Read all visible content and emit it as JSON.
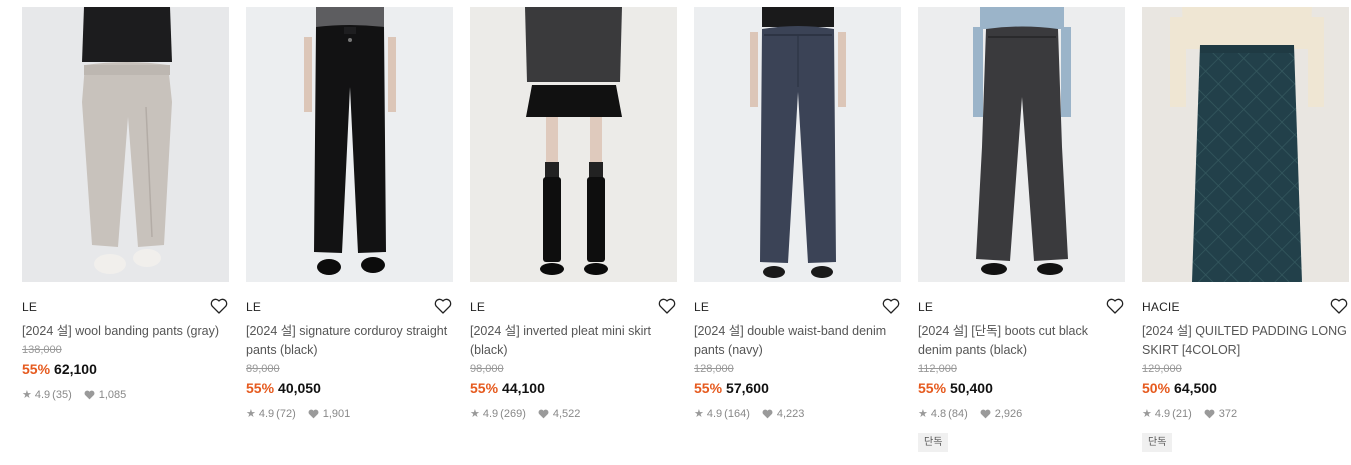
{
  "products": [
    {
      "brand": "LE",
      "name": "[2024 설] wool banding pants (gray)",
      "original_price": "138,000",
      "discount": "55%",
      "price": "62,100",
      "rating": "4.9",
      "reviews": "(35)",
      "likes": "1,085",
      "tag": ""
    },
    {
      "brand": "LE",
      "name": "[2024 설] signature corduroy straight pants (black)",
      "original_price": "89,000",
      "discount": "55%",
      "price": "40,050",
      "rating": "4.9",
      "reviews": "(72)",
      "likes": "1,901",
      "tag": ""
    },
    {
      "brand": "LE",
      "name": "[2024 설] inverted pleat mini skirt (black)",
      "original_price": "98,000",
      "discount": "55%",
      "price": "44,100",
      "rating": "4.9",
      "reviews": "(269)",
      "likes": "4,522",
      "tag": ""
    },
    {
      "brand": "LE",
      "name": "[2024 설] double waist-band denim pants (navy)",
      "original_price": "128,000",
      "discount": "55%",
      "price": "57,600",
      "rating": "4.9",
      "reviews": "(164)",
      "likes": "4,223",
      "tag": ""
    },
    {
      "brand": "LE",
      "name": "[2024 설] [단독] boots cut black denim pants (black)",
      "original_price": "112,000",
      "discount": "55%",
      "price": "50,400",
      "rating": "4.8",
      "reviews": "(84)",
      "likes": "2,926",
      "tag": "단독"
    },
    {
      "brand": "HACIE",
      "name": "[2024 설] QUILTED PADDING LONG SKIRT [4COLOR]",
      "original_price": "129,000",
      "discount": "50%",
      "price": "64,500",
      "rating": "4.9",
      "reviews": "(21)",
      "likes": "372",
      "tag": "단독"
    }
  ],
  "colors": {
    "discount": "#e65a1e",
    "price": "#111111",
    "muted": "#999999"
  },
  "icons": {
    "wishlist": "heart-outline-icon",
    "rating": "star-icon",
    "likes": "heart-filled-icon"
  }
}
